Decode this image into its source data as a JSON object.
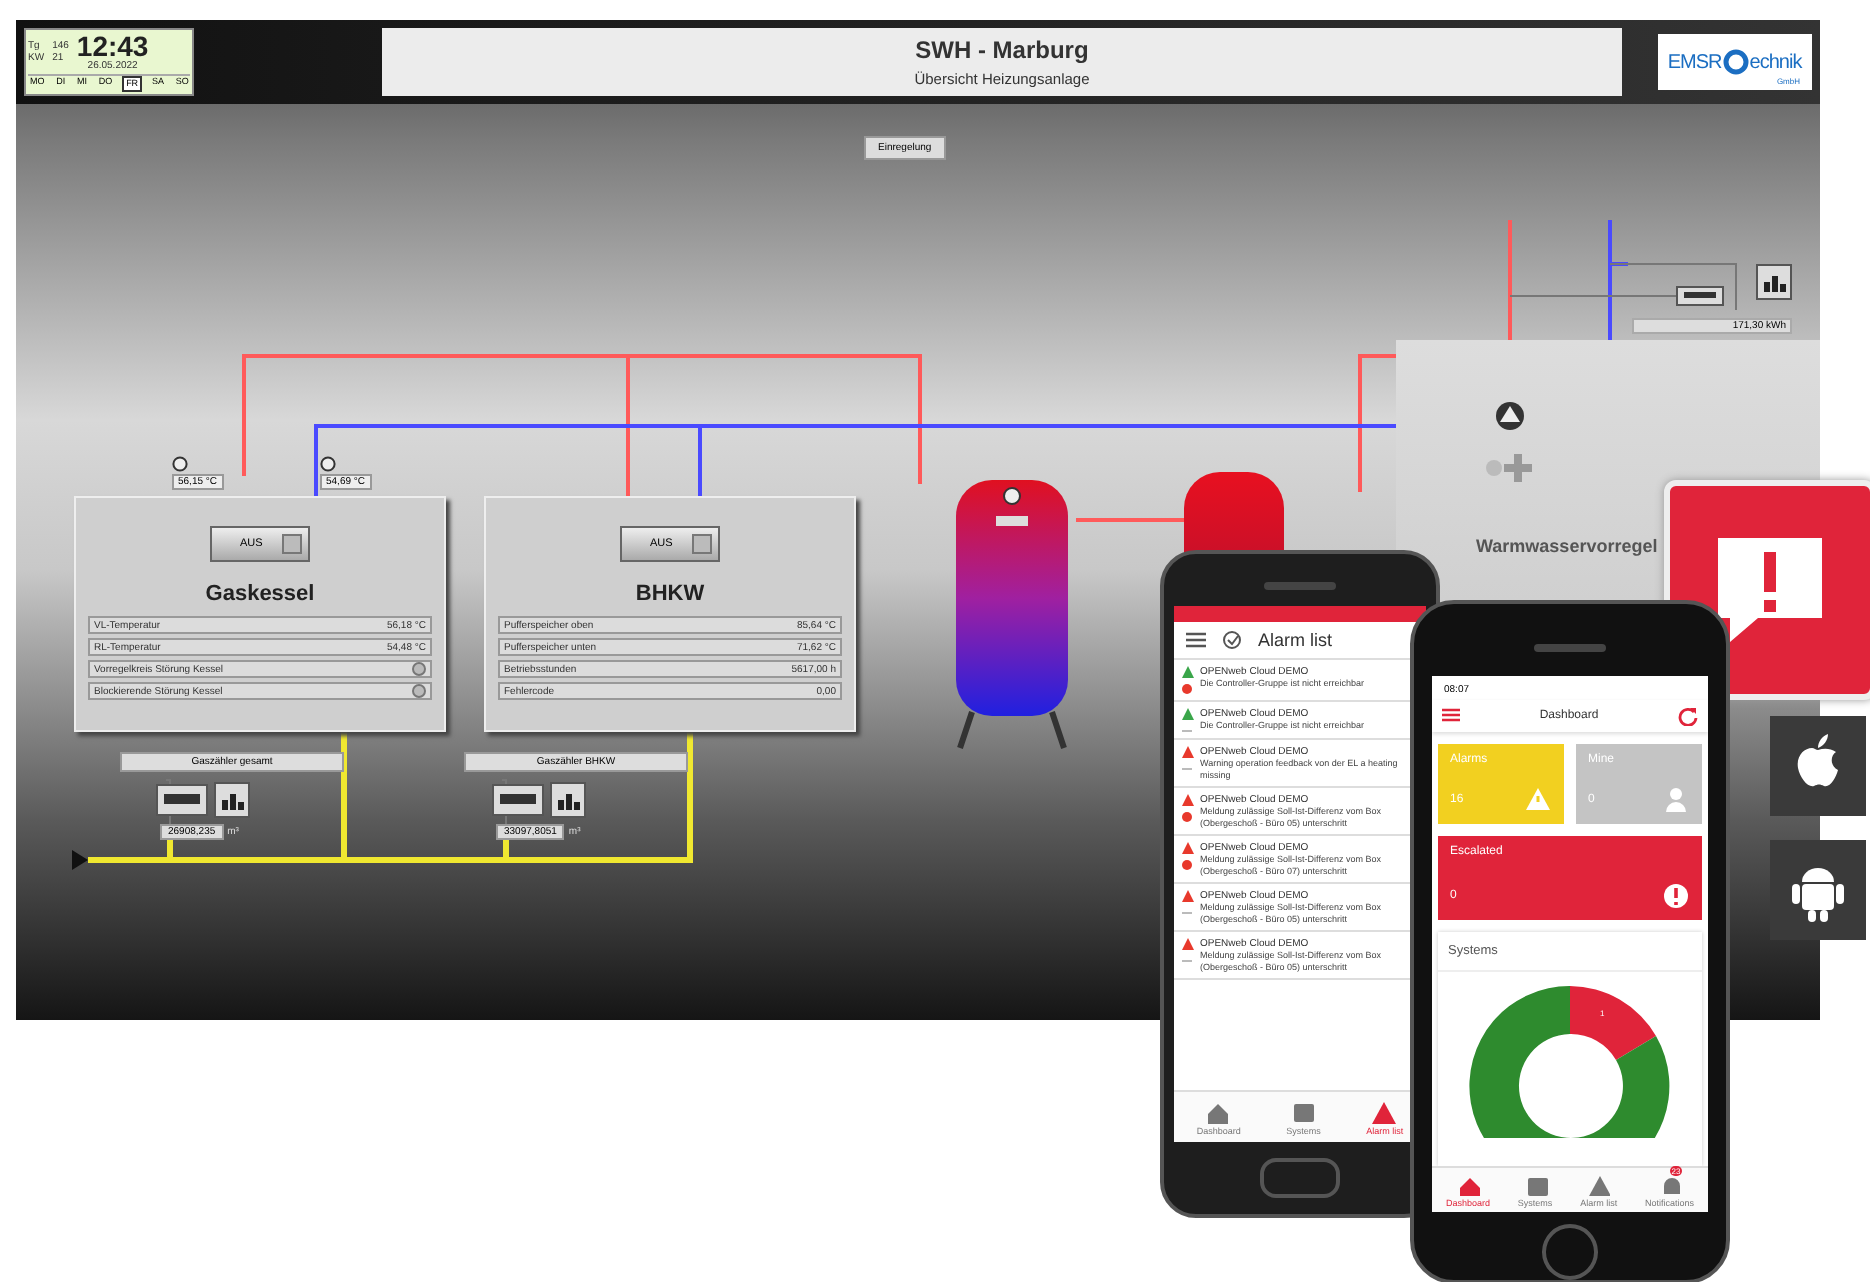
{
  "scada": {
    "clock": {
      "day_label": "Tg",
      "day": "146",
      "week_label": "KW",
      "week": "21",
      "time": "12:43",
      "date": "26.05.2022",
      "weekdays": [
        {
          "label": "MO",
          "selected": false
        },
        {
          "label": "DI",
          "selected": false
        },
        {
          "label": "MI",
          "selected": false
        },
        {
          "label": "DO",
          "selected": false
        },
        {
          "label": "FR",
          "selected": true
        },
        {
          "label": "SA",
          "selected": false
        },
        {
          "label": "SO",
          "selected": false
        }
      ]
    },
    "title": "SWH - Marburg",
    "subtitle": "Übersicht Heizungsanlage",
    "logo": {
      "left": "EMSR",
      "right": "echnik",
      "small": "GmbH"
    },
    "button": "Einregelung",
    "sensors": [
      {
        "value": "56,15 °C"
      },
      {
        "value": "54,69 °C"
      }
    ],
    "units": [
      {
        "title": "Gaskessel",
        "switch": "AUS",
        "rows": [
          {
            "kind": "value",
            "label": "VL-Temperatur",
            "value": "56,18 °C"
          },
          {
            "kind": "value",
            "label": "RL-Temperatur",
            "value": "54,48 °C"
          },
          {
            "kind": "lamp",
            "label": "Vorregelkreis Störung Kessel"
          },
          {
            "kind": "lamp",
            "label": "Blockierende Störung Kessel"
          }
        ],
        "meter": {
          "label": "Gaszähler gesamt",
          "value": "26908,235",
          "unit": "m³"
        }
      },
      {
        "title": "BHKW",
        "switch": "AUS",
        "rows": [
          {
            "kind": "value",
            "label": "Pufferspeicher oben",
            "value": "85,64 °C"
          },
          {
            "kind": "value",
            "label": "Pufferspeicher unten",
            "value": "71,62 °C"
          },
          {
            "kind": "value",
            "label": "Betriebsstunden",
            "value": "5617,00 h"
          },
          {
            "kind": "value",
            "label": "Fehlercode",
            "value": "0,00"
          }
        ],
        "meter": {
          "label": "Gaszähler BHKW",
          "value": "33097,8051",
          "unit": "m³"
        }
      }
    ],
    "warm_water": {
      "label": "Warmwasservorregel",
      "reading": "171,30 kWh"
    }
  },
  "alarm_phone": {
    "title": "Alarm list",
    "alarms": [
      {
        "title": "OPENweb Cloud DEMO",
        "message": "Die Controller-Gruppe ist nicht erreichbar",
        "color": "#3aa64a",
        "active": true
      },
      {
        "title": "OPENweb Cloud DEMO",
        "message": "Die Controller-Gruppe ist nicht erreichbar",
        "color": "#3aa64a",
        "active": false
      },
      {
        "title": "OPENweb Cloud DEMO",
        "message": "Warning operation feedback von der EL a heating missing",
        "color": "#e8392c",
        "active": false
      },
      {
        "title": "OPENweb Cloud DEMO",
        "message": "Meldung zulässige Soll-Ist-Differenz vom Box (Obergeschoß - Büro 05) unterschritt",
        "color": "#e8392c",
        "active": true
      },
      {
        "title": "OPENweb Cloud DEMO",
        "message": "Meldung zulässige Soll-Ist-Differenz vom Box (Obergeschoß - Büro 07) unterschritt",
        "color": "#e8392c",
        "active": true
      },
      {
        "title": "OPENweb Cloud DEMO",
        "message": "Meldung zulässige Soll-Ist-Differenz vom Box (Obergeschoß - Büro 05) unterschritt",
        "color": "#e8392c",
        "active": false
      },
      {
        "title": "OPENweb Cloud DEMO",
        "message": "Meldung zulässige Soll-Ist-Differenz vom Box (Obergeschoß - Büro 05) unterschritt",
        "color": "#e8392c",
        "active": false
      }
    ],
    "nav": [
      {
        "label": "Dashboard",
        "kind": "home",
        "selected": false
      },
      {
        "label": "Systems",
        "kind": "systems",
        "selected": false
      },
      {
        "label": "Alarm list",
        "kind": "alarm",
        "selected": true
      }
    ]
  },
  "dashboard_phone": {
    "time": "08:07",
    "title": "Dashboard",
    "tiles": [
      {
        "label": "Alarms",
        "value": "16",
        "color": "#f2d020",
        "kind": "warning"
      },
      {
        "label": "Mine",
        "value": "0",
        "color": "#c4c4c4",
        "kind": "person"
      },
      {
        "label": "Escalated",
        "value": "0",
        "color": "#e0243a",
        "kind": "exclaim"
      }
    ],
    "systems": {
      "title": "Systems",
      "slice_label": "1"
    },
    "nav": [
      {
        "label": "Dashboard",
        "kind": "home",
        "selected": true
      },
      {
        "label": "Systems",
        "kind": "systems",
        "selected": false
      },
      {
        "label": "Alarm list",
        "kind": "alarm",
        "selected": false
      },
      {
        "label": "Notifications",
        "kind": "bell",
        "selected": false,
        "badge": "23"
      }
    ]
  }
}
